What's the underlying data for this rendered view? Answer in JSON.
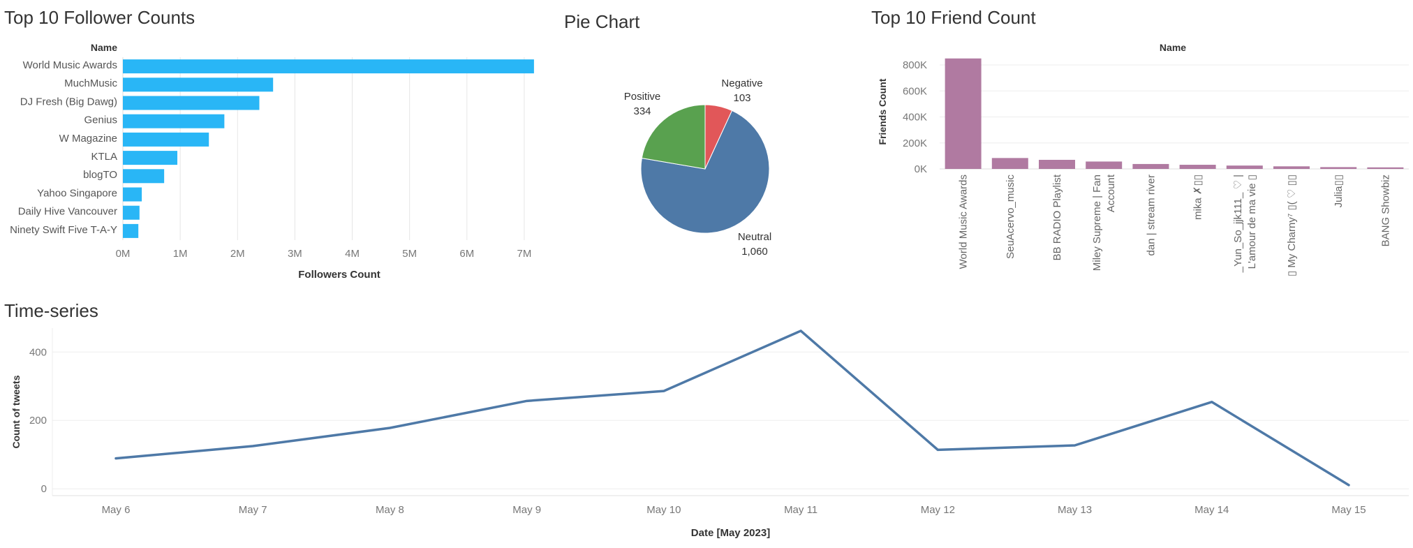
{
  "dashboard": {
    "follower_title": "Top 10 Follower Counts",
    "pie_title": "Pie Chart",
    "friend_title": "Top 10 Friend Count",
    "timeseries_title": "Time-series"
  },
  "colors": {
    "followers_bar": "#29b6f6",
    "friends_bar": "#b07aa1",
    "line": "#4e79a7",
    "pie_positive": "#59a14f",
    "pie_negative": "#e15759",
    "pie_neutral": "#4e79a7"
  },
  "chart_data": [
    {
      "id": "followers",
      "type": "bar",
      "orientation": "horizontal",
      "title": "Top 10 Follower Counts",
      "category_header": "Name",
      "xlabel": "Followers Count",
      "categories": [
        "World Music Awards",
        "MuchMusic",
        "DJ Fresh (Big Dawg)",
        "Genius",
        "W Magazine",
        "KTLA",
        "blogTO",
        "Yahoo Singapore",
        "Daily Hive Vancouver",
        "Ninety Swift Five T-A-Y"
      ],
      "values": [
        7170000,
        2620000,
        2380000,
        1770000,
        1500000,
        950000,
        720000,
        330000,
        290000,
        270000
      ],
      "xticks": [
        0,
        1000000,
        2000000,
        3000000,
        4000000,
        5000000,
        6000000,
        7000000
      ],
      "xtick_labels": [
        "0M",
        "1M",
        "2M",
        "3M",
        "4M",
        "5M",
        "6M",
        "7M"
      ],
      "xlim": [
        0,
        7500000
      ],
      "grid": true
    },
    {
      "id": "sentiment",
      "type": "pie",
      "title": "Pie Chart",
      "slices": [
        {
          "label": "Negative",
          "value": 103,
          "display": "103"
        },
        {
          "label": "Neutral",
          "value": 1060,
          "display": "1,060"
        },
        {
          "label": "Positive",
          "value": 334,
          "display": "334"
        }
      ]
    },
    {
      "id": "friends",
      "type": "bar",
      "orientation": "vertical",
      "title": "Top 10 Friend Count",
      "category_header": "Name",
      "ylabel": "Friends Count",
      "categories": [
        [
          "World Music Awards"
        ],
        [
          "SeuAcervo_music"
        ],
        [
          "BB RADIO Playlist"
        ],
        [
          "Miley Supreme | Fan",
          "Account"
        ],
        [
          "dan | stream river"
        ],
        [
          "mika ✗▯▯"
        ],
        [
          "_Yun_So_jjk111_ ♡ |",
          "L'amour de ma vie ▯"
        ],
        [
          "▯ My Charny⁷ ▯( ♡ ▯▯"
        ],
        [
          "Julia▯▯"
        ],
        [
          "BANG Showbiz"
        ]
      ],
      "values": [
        850000,
        84000,
        70000,
        57000,
        38000,
        32000,
        26000,
        20000,
        14000,
        12000
      ],
      "yticks": [
        0,
        200000,
        400000,
        600000,
        800000
      ],
      "ytick_labels": [
        "0K",
        "200K",
        "400K",
        "600K",
        "800K"
      ],
      "ylim": [
        0,
        870000
      ],
      "grid": true
    },
    {
      "id": "timeseries",
      "type": "line",
      "title": "Time-series",
      "xlabel": "Date [May 2023]",
      "ylabel": "Count of tweets",
      "x": [
        "May 6",
        "May 7",
        "May 8",
        "May 9",
        "May 10",
        "May 11",
        "May 12",
        "May 13",
        "May 14",
        "May 15"
      ],
      "series": [
        {
          "values": [
            89,
            125,
            178,
            257,
            286,
            462,
            114,
            127,
            254,
            11
          ]
        }
      ],
      "yticks": [
        0,
        200,
        400
      ],
      "ytick_labels": [
        "0",
        "200",
        "400"
      ],
      "ylim": [
        -20,
        470
      ],
      "grid": true
    }
  ]
}
